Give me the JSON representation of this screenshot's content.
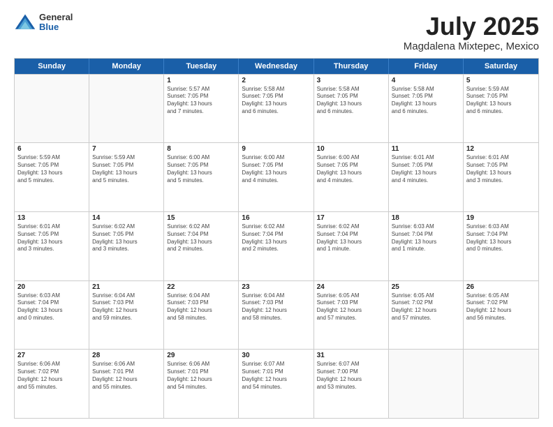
{
  "logo": {
    "general": "General",
    "blue": "Blue"
  },
  "title": "July 2025",
  "location": "Magdalena Mixtepec, Mexico",
  "weekdays": [
    "Sunday",
    "Monday",
    "Tuesday",
    "Wednesday",
    "Thursday",
    "Friday",
    "Saturday"
  ],
  "weeks": [
    [
      {
        "day": "",
        "text": "",
        "empty": true
      },
      {
        "day": "",
        "text": "",
        "empty": true
      },
      {
        "day": "1",
        "text": "Sunrise: 5:57 AM\nSunset: 7:05 PM\nDaylight: 13 hours\nand 7 minutes."
      },
      {
        "day": "2",
        "text": "Sunrise: 5:58 AM\nSunset: 7:05 PM\nDaylight: 13 hours\nand 6 minutes."
      },
      {
        "day": "3",
        "text": "Sunrise: 5:58 AM\nSunset: 7:05 PM\nDaylight: 13 hours\nand 6 minutes."
      },
      {
        "day": "4",
        "text": "Sunrise: 5:58 AM\nSunset: 7:05 PM\nDaylight: 13 hours\nand 6 minutes."
      },
      {
        "day": "5",
        "text": "Sunrise: 5:59 AM\nSunset: 7:05 PM\nDaylight: 13 hours\nand 6 minutes."
      }
    ],
    [
      {
        "day": "6",
        "text": "Sunrise: 5:59 AM\nSunset: 7:05 PM\nDaylight: 13 hours\nand 5 minutes."
      },
      {
        "day": "7",
        "text": "Sunrise: 5:59 AM\nSunset: 7:05 PM\nDaylight: 13 hours\nand 5 minutes."
      },
      {
        "day": "8",
        "text": "Sunrise: 6:00 AM\nSunset: 7:05 PM\nDaylight: 13 hours\nand 5 minutes."
      },
      {
        "day": "9",
        "text": "Sunrise: 6:00 AM\nSunset: 7:05 PM\nDaylight: 13 hours\nand 4 minutes."
      },
      {
        "day": "10",
        "text": "Sunrise: 6:00 AM\nSunset: 7:05 PM\nDaylight: 13 hours\nand 4 minutes."
      },
      {
        "day": "11",
        "text": "Sunrise: 6:01 AM\nSunset: 7:05 PM\nDaylight: 13 hours\nand 4 minutes."
      },
      {
        "day": "12",
        "text": "Sunrise: 6:01 AM\nSunset: 7:05 PM\nDaylight: 13 hours\nand 3 minutes."
      }
    ],
    [
      {
        "day": "13",
        "text": "Sunrise: 6:01 AM\nSunset: 7:05 PM\nDaylight: 13 hours\nand 3 minutes."
      },
      {
        "day": "14",
        "text": "Sunrise: 6:02 AM\nSunset: 7:05 PM\nDaylight: 13 hours\nand 3 minutes."
      },
      {
        "day": "15",
        "text": "Sunrise: 6:02 AM\nSunset: 7:04 PM\nDaylight: 13 hours\nand 2 minutes."
      },
      {
        "day": "16",
        "text": "Sunrise: 6:02 AM\nSunset: 7:04 PM\nDaylight: 13 hours\nand 2 minutes."
      },
      {
        "day": "17",
        "text": "Sunrise: 6:02 AM\nSunset: 7:04 PM\nDaylight: 13 hours\nand 1 minute."
      },
      {
        "day": "18",
        "text": "Sunrise: 6:03 AM\nSunset: 7:04 PM\nDaylight: 13 hours\nand 1 minute."
      },
      {
        "day": "19",
        "text": "Sunrise: 6:03 AM\nSunset: 7:04 PM\nDaylight: 13 hours\nand 0 minutes."
      }
    ],
    [
      {
        "day": "20",
        "text": "Sunrise: 6:03 AM\nSunset: 7:04 PM\nDaylight: 13 hours\nand 0 minutes."
      },
      {
        "day": "21",
        "text": "Sunrise: 6:04 AM\nSunset: 7:03 PM\nDaylight: 12 hours\nand 59 minutes."
      },
      {
        "day": "22",
        "text": "Sunrise: 6:04 AM\nSunset: 7:03 PM\nDaylight: 12 hours\nand 58 minutes."
      },
      {
        "day": "23",
        "text": "Sunrise: 6:04 AM\nSunset: 7:03 PM\nDaylight: 12 hours\nand 58 minutes."
      },
      {
        "day": "24",
        "text": "Sunrise: 6:05 AM\nSunset: 7:03 PM\nDaylight: 12 hours\nand 57 minutes."
      },
      {
        "day": "25",
        "text": "Sunrise: 6:05 AM\nSunset: 7:02 PM\nDaylight: 12 hours\nand 57 minutes."
      },
      {
        "day": "26",
        "text": "Sunrise: 6:05 AM\nSunset: 7:02 PM\nDaylight: 12 hours\nand 56 minutes."
      }
    ],
    [
      {
        "day": "27",
        "text": "Sunrise: 6:06 AM\nSunset: 7:02 PM\nDaylight: 12 hours\nand 55 minutes."
      },
      {
        "day": "28",
        "text": "Sunrise: 6:06 AM\nSunset: 7:01 PM\nDaylight: 12 hours\nand 55 minutes."
      },
      {
        "day": "29",
        "text": "Sunrise: 6:06 AM\nSunset: 7:01 PM\nDaylight: 12 hours\nand 54 minutes."
      },
      {
        "day": "30",
        "text": "Sunrise: 6:07 AM\nSunset: 7:01 PM\nDaylight: 12 hours\nand 54 minutes."
      },
      {
        "day": "31",
        "text": "Sunrise: 6:07 AM\nSunset: 7:00 PM\nDaylight: 12 hours\nand 53 minutes."
      },
      {
        "day": "",
        "text": "",
        "empty": true
      },
      {
        "day": "",
        "text": "",
        "empty": true
      }
    ]
  ]
}
